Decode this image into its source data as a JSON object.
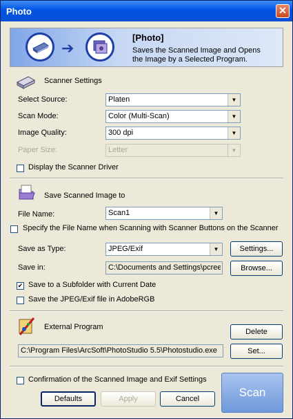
{
  "window": {
    "title": "Photo",
    "close_glyph": "✕"
  },
  "banner": {
    "title": "[Photo]",
    "description": "Saves the Scanned Image and Opens the Image by a Selected Program."
  },
  "scanner_settings": {
    "heading": "Scanner Settings",
    "select_source": {
      "label": "Select Source:",
      "value": "Platen"
    },
    "scan_mode": {
      "label": "Scan Mode:",
      "value": "Color (Multi-Scan)"
    },
    "image_quality": {
      "label": "Image Quality:",
      "value": "300 dpi"
    },
    "paper_size": {
      "label": "Paper Size:",
      "value": "Letter"
    },
    "display_driver": {
      "label": "Display the Scanner Driver",
      "checked": false
    }
  },
  "save_section": {
    "heading": "Save Scanned Image to",
    "file_name": {
      "label": "File Name:",
      "value": "Scan1"
    },
    "specify_name": {
      "label": "Specify the File Name when Scanning with Scanner Buttons on the Scanner",
      "checked": false
    },
    "save_as_type": {
      "label": "Save as Type:",
      "value": "JPEG/Exif"
    },
    "settings_button": "Settings...",
    "save_in": {
      "label": "Save in:",
      "value": "C:\\Documents and Settings\\pcreecy"
    },
    "browse_button": "Browse...",
    "subfolder": {
      "label": "Save to a Subfolder with Current Date",
      "checked": true
    },
    "adobergb": {
      "label": "Save the JPEG/Exif file in AdobeRGB",
      "checked": false
    }
  },
  "external_program": {
    "heading": "External Program",
    "path": "C:\\Program Files\\ArcSoft\\PhotoStudio 5.5\\Photostudio.exe",
    "delete_button": "Delete",
    "set_button": "Set..."
  },
  "footer": {
    "confirmation": {
      "label": "Confirmation of the Scanned Image and Exif Settings",
      "checked": false
    },
    "defaults_button": "Defaults",
    "apply_button": "Apply",
    "cancel_button": "Cancel",
    "scan_button": "Scan"
  },
  "glyphs": {
    "dropdown": "▼",
    "check": "✔",
    "arrow": "➔"
  },
  "colors": {
    "title_bar": "#0054e3",
    "accent": "#1f3fa8",
    "scan_button": "#6f98dc"
  }
}
